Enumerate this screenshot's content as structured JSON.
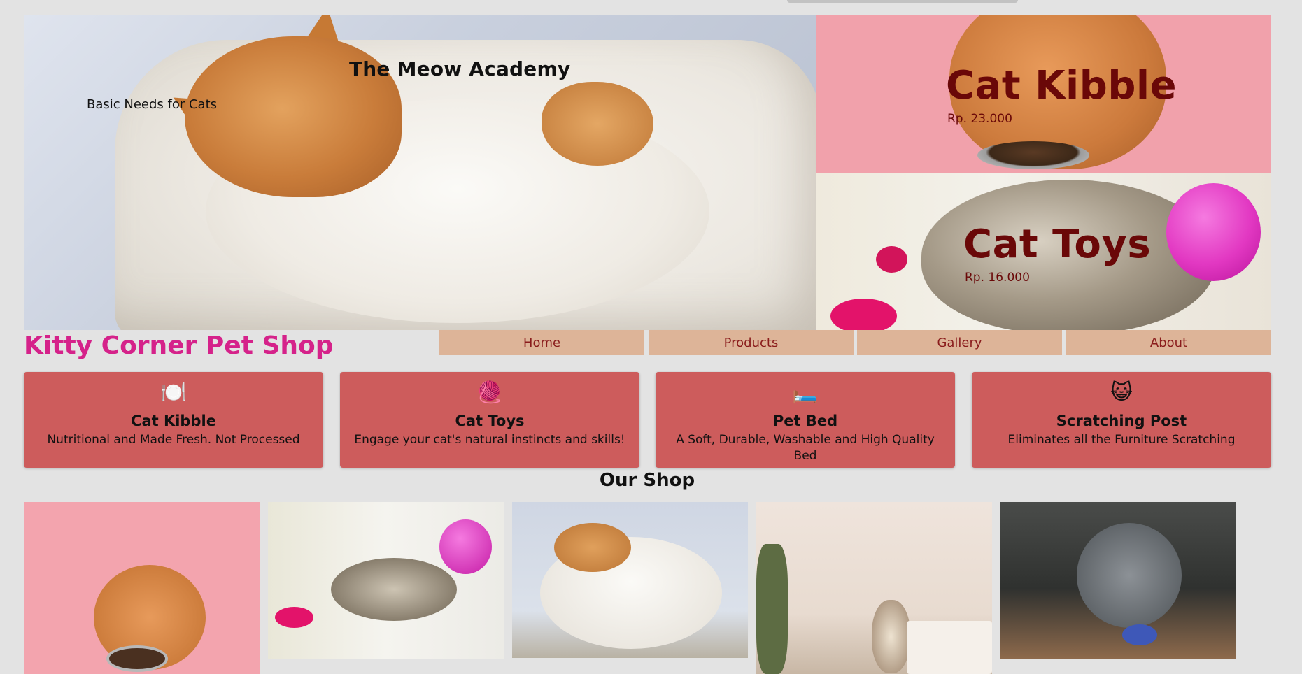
{
  "hero": {
    "brand": "The Meow Academy",
    "tagline": "Basic Needs for Cats"
  },
  "promos": [
    {
      "title": "Cat Kibble",
      "price": "Rp. 23.000"
    },
    {
      "title": "Cat Toys",
      "price": "Rp. 16.000"
    }
  ],
  "header": {
    "shop_name": "Kitty Corner Pet Shop"
  },
  "nav": {
    "items": [
      {
        "label": "Home"
      },
      {
        "label": "Products"
      },
      {
        "label": "Gallery"
      },
      {
        "label": "About"
      }
    ]
  },
  "features": [
    {
      "icon": "🍽️",
      "title": "Cat Kibble",
      "desc": "Nutritional and Made Fresh. Not Processed"
    },
    {
      "icon": "🧶",
      "title": "Cat Toys",
      "desc": "Engage your cat's natural instincts and skills!"
    },
    {
      "icon": "🛏️",
      "title": "Pet Bed",
      "desc": "A Soft, Durable, Washable and High Quality Bed"
    },
    {
      "icon": "😺",
      "title": "Scratching Post",
      "desc": "Eliminates all the Furniture Scratching"
    }
  ],
  "shop": {
    "heading": "Our Shop"
  }
}
